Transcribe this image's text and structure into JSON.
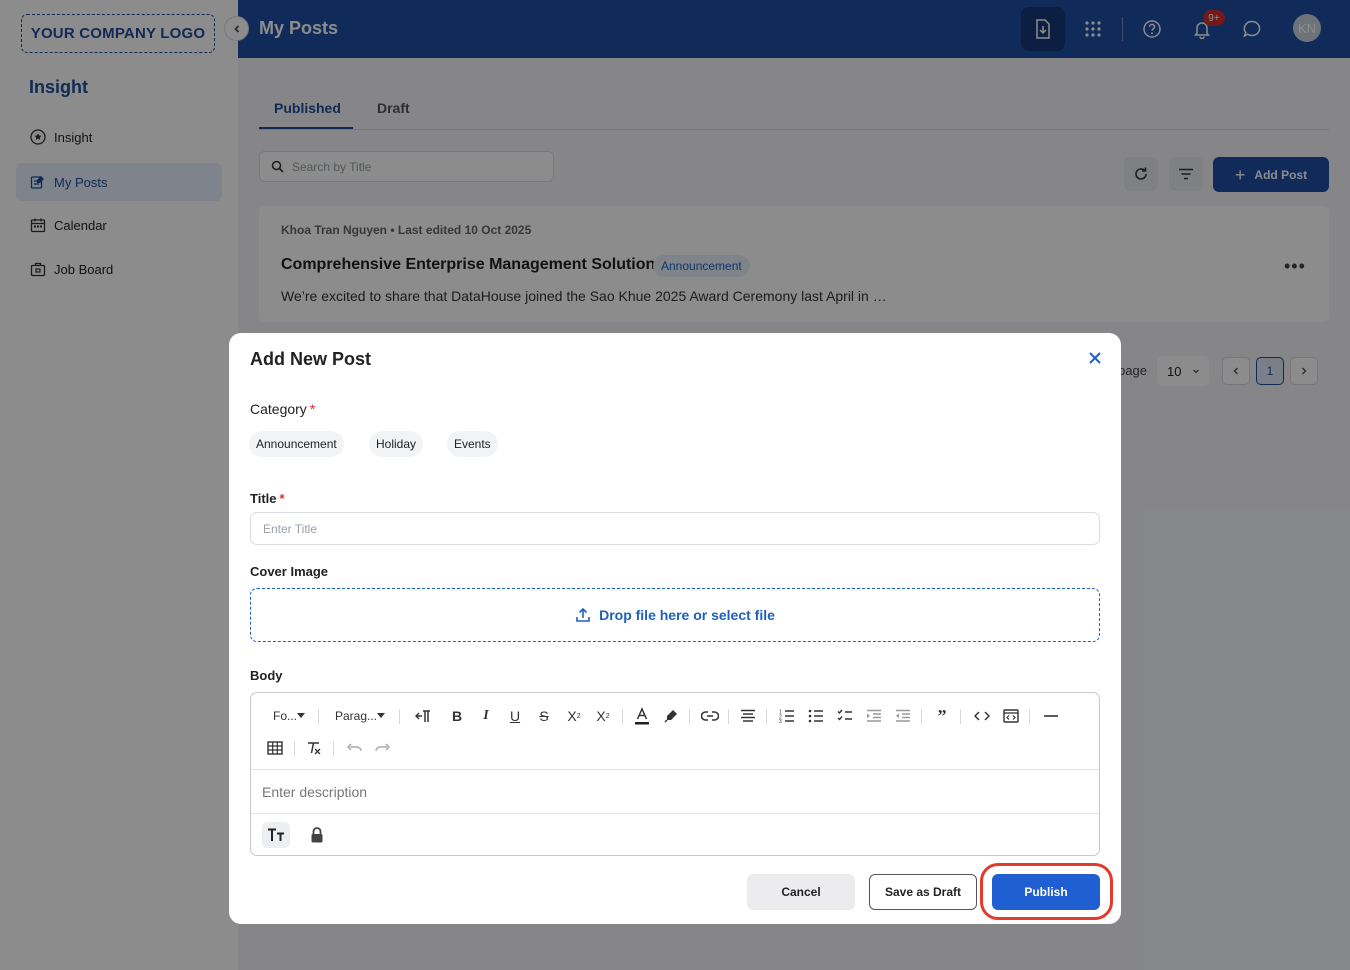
{
  "logo": {
    "text": "YOUR COMPANY LOGO"
  },
  "sidebar": {
    "title": "Insight",
    "items": [
      {
        "label": "Insight",
        "icon": "star-circle-icon"
      },
      {
        "label": "My Posts",
        "icon": "edit-note-icon",
        "active": true
      },
      {
        "label": "Calendar",
        "icon": "calendar-icon"
      },
      {
        "label": "Job Board",
        "icon": "briefcase-icon"
      }
    ]
  },
  "header": {
    "title": "My Posts",
    "notification_badge": "9+",
    "avatar_initials": "KN"
  },
  "main": {
    "tabs": [
      {
        "label": "Published",
        "active": true
      },
      {
        "label": "Draft"
      }
    ],
    "search": {
      "placeholder": "Search by Title"
    },
    "add_post_label": "Add Post",
    "post": {
      "meta": "Khoa Tran Nguyen • Last edited 10 Oct 2025",
      "title": "Comprehensive Enterprise Management Solution",
      "tag": "Announcement",
      "excerpt": "We’re excited to share that DataHouse joined the Sao Khue 2025 Award Ceremony last April in …"
    },
    "pagination": {
      "label_fragment": "page",
      "page_size": "10",
      "current_page": "1"
    }
  },
  "modal": {
    "title": "Add New Post",
    "category_label": "Category",
    "required_mark": "*",
    "categories": [
      "Announcement",
      "Holiday",
      "Events"
    ],
    "title_label": "Title",
    "title_placeholder": "Enter Title",
    "cover_label": "Cover Image",
    "dropzone_text": "Drop file here or select file",
    "body_label": "Body",
    "toolbar": {
      "font_select": "Fo...",
      "block_select": "Parag..."
    },
    "body_placeholder": "Enter description",
    "buttons": {
      "cancel": "Cancel",
      "save_draft": "Save as Draft",
      "publish": "Publish"
    }
  },
  "colors": {
    "brand": "#1e4fa3",
    "accent": "#1f5fd1",
    "highlight": "#e23b2e",
    "required": "#d32f2f"
  }
}
